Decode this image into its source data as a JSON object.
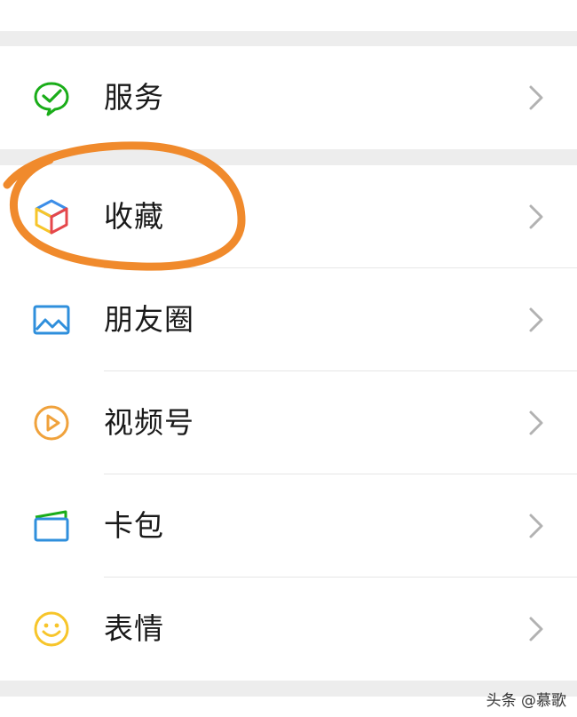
{
  "menu": {
    "items": [
      {
        "label": "服务",
        "icon": "wechat-pay-check-icon",
        "color": "#1aad19"
      },
      {
        "label": "收藏",
        "icon": "cube-icon",
        "color": "#3d8ee8"
      },
      {
        "label": "朋友圈",
        "icon": "image-landscape-icon",
        "color": "#2f8fdc"
      },
      {
        "label": "视频号",
        "icon": "play-circle-icon",
        "color": "#f0a23c"
      },
      {
        "label": "卡包",
        "icon": "wallet-card-icon",
        "color": "#2f8fdc"
      },
      {
        "label": "表情",
        "icon": "smiley-face-icon",
        "color": "#f7c52a"
      }
    ]
  },
  "annotation": {
    "color": "#f08a2c",
    "target": "收藏"
  },
  "watermark": "头条 @慕歌",
  "colors": {
    "background": "#ededed",
    "row": "#ffffff",
    "chevron": "#b2b2b2"
  }
}
